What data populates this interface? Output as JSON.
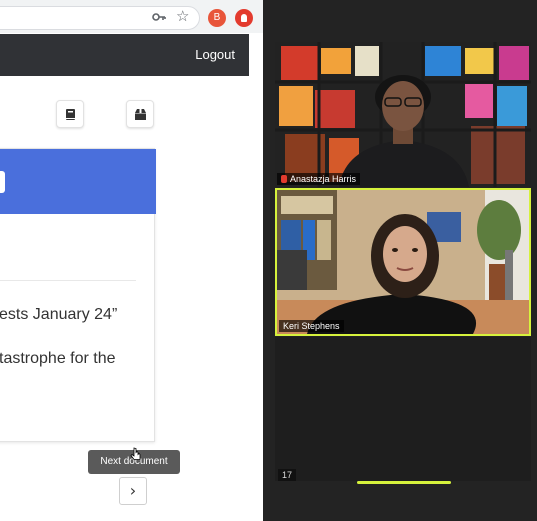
{
  "browser": {
    "ext_badge": "B",
    "colors": {
      "ext_orange": "#e8553a",
      "ext_red": "#e33b2e"
    }
  },
  "navbar": {
    "logout_label": "Logout"
  },
  "toolbar": {
    "icons": [
      "book-icon",
      "archive-box-icon"
    ]
  },
  "document": {
    "header_color": "#4a6fdc",
    "line1": "ests January 24”",
    "line2": "tastrophe for the"
  },
  "pager": {
    "tooltip": "Next document",
    "next_glyph": "›"
  },
  "call": {
    "participants": [
      {
        "name": "Anastazja Harris",
        "muted": true
      },
      {
        "name": "Keri Stephens",
        "active_speaker": true
      }
    ],
    "page_number": "17",
    "highlight_color": "#d6f23c"
  }
}
